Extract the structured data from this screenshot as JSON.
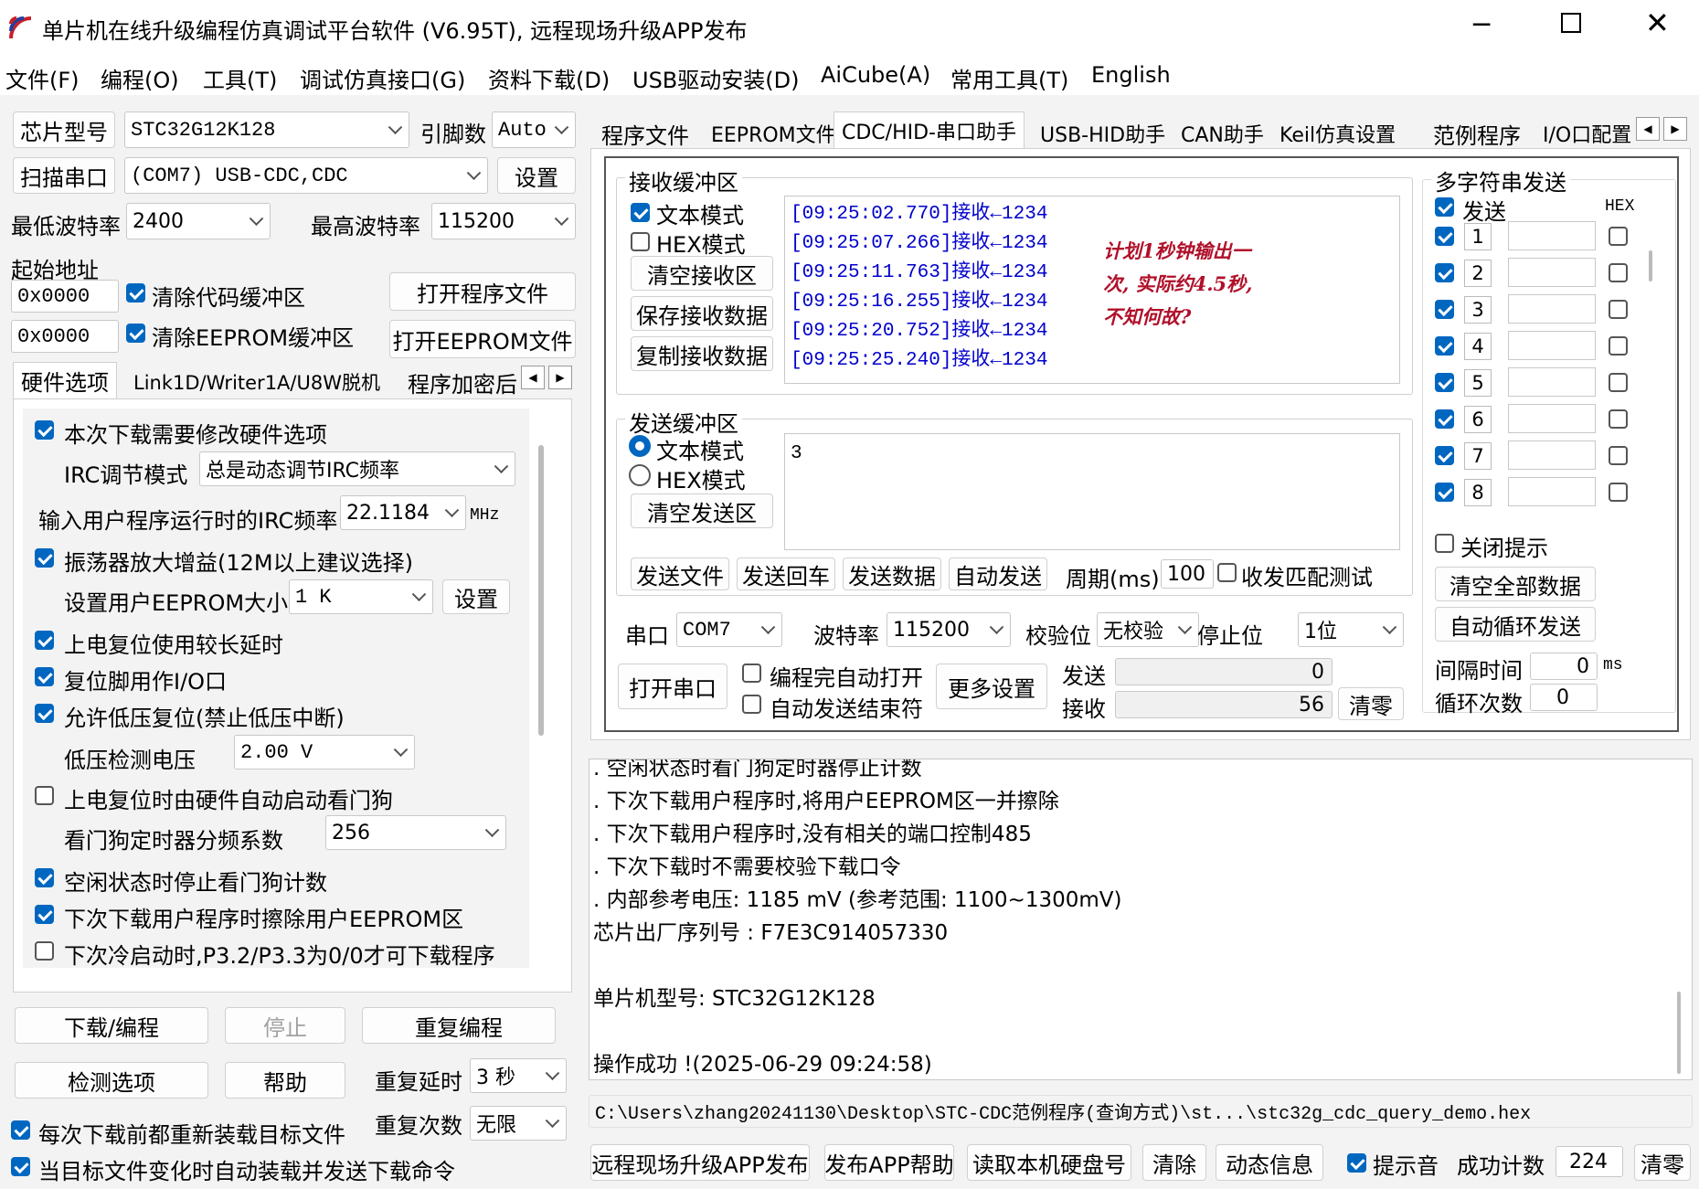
{
  "window": {
    "title": "单片机在线升级编程仿真调试平台软件 (V6.95T), 远程现场升级APP发布"
  },
  "menu": [
    "文件(F)",
    "编程(O)",
    "工具(T)",
    "调试仿真接口(G)",
    "资料下载(D)",
    "USB驱动安装(D)",
    "AiCube(A)",
    "常用工具(T)",
    "English"
  ],
  "left": {
    "chip_btn": "芯片型号",
    "chip_value": "STC32G12K128",
    "pins_label": "引脚数",
    "pins_value": "Auto",
    "scan_btn": "扫描串口",
    "port_value": "(COM7) USB-CDC,CDC",
    "settings_btn": "设置",
    "min_baud_label": "最低波特率",
    "min_baud_value": "2400",
    "max_baud_label": "最高波特率",
    "max_baud_value": "115200",
    "start_addr_label": "起始地址",
    "addr1": "0x0000",
    "clear_code_label": "清除代码缓冲区",
    "open_prog_btn": "打开程序文件",
    "addr2": "0x0000",
    "clear_eeprom_label": "清除EEPROM缓冲区",
    "open_eeprom_btn": "打开EEPROM文件",
    "tabs": [
      "硬件选项",
      "Link1D/Writer1A/U8W脱机",
      "程序加密后"
    ],
    "hw": {
      "opt1": "本次下载需要修改硬件选项",
      "irc_mode_label": "IRC调节模式",
      "irc_mode_value": "总是动态调节IRC频率",
      "irc_freq_label": "输入用户程序运行时的IRC频率",
      "irc_freq_value": "22.1184",
      "irc_unit": "MHz",
      "opt2": "振荡器放大增益(12M以上建议选择)",
      "eeprom_size_label": "设置用户EEPROM大小",
      "eeprom_size_value": "1  K",
      "eeprom_set_btn": "设置",
      "opt3": "上电复位使用较长延时",
      "opt4": "复位脚用作I/O口",
      "opt5": "允许低压复位(禁止低压中断)",
      "lv_label": "低压检测电压",
      "lv_value": "2.00 V",
      "opt6": "上电复位时由硬件自动启动看门狗",
      "wdt_label": "看门狗定时器分频系数",
      "wdt_value": "256",
      "opt7": "空闲状态时停止看门狗计数",
      "opt8": "下次下载用户程序时擦除用户EEPROM区",
      "opt9": "下次冷启动时,P3.2/P3.3为0/0才可下载程序"
    },
    "download_btn": "下载/编程",
    "stop_btn": "停止",
    "repeat_btn": "重复编程",
    "detect_btn": "检测选项",
    "help_btn": "帮助",
    "repeat_delay_label": "重复延时",
    "repeat_delay_value": "3 秒",
    "repeat_count_label": "重复次数",
    "repeat_count_value": "无限",
    "reload_label": "每次下载前都重新装载目标文件",
    "autoload_label": "当目标文件变化时自动装载并发送下载命令"
  },
  "right": {
    "tabs": [
      "程序文件",
      "EEPROM文件",
      "CDC/HID-串口助手",
      "USB-HID助手",
      "CAN助手",
      "Keil仿真设置",
      "范例程序",
      "I/O口配置"
    ],
    "recv": {
      "title": "接收缓冲区",
      "text_mode": "文本模式",
      "hex_mode": "HEX模式",
      "clear_btn": "清空接收区",
      "save_btn": "保存接收数据",
      "copy_btn": "复制接收数据",
      "lines": [
        "[09:25:02.770]接收←1234",
        "[09:25:07.266]接收←1234",
        "[09:25:11.763]接收←1234",
        "[09:25:16.255]接收←1234",
        "[09:25:20.752]接收←1234",
        "[09:25:25.240]接收←1234"
      ],
      "annotation": "计划1秒钟输出一\n次, 实际约4.5秒,\n不知何故?"
    },
    "send": {
      "title": "发送缓冲区",
      "text_mode": "文本模式",
      "hex_mode": "HEX模式",
      "clear_btn": "清空发送区",
      "content": "3",
      "send_file_btn": "发送文件",
      "send_cr_btn": "发送回车",
      "send_data_btn": "发送数据",
      "auto_send_btn": "自动发送",
      "period_label": "周期(ms)",
      "period_value": "100",
      "match_test_label": "收发匹配测试"
    },
    "port_label": "串口",
    "port_value": "COM7",
    "baud_label": "波特率",
    "baud_value": "115200",
    "parity_label": "校验位",
    "parity_value": "无校验",
    "stop_label": "停止位",
    "stop_value": "1位",
    "open_port_btn": "打开串口",
    "auto_open_label": "编程完自动打开",
    "auto_end_label": "自动发送结束符",
    "more_btn": "更多设置",
    "sent_label": "发送",
    "sent_value": "0",
    "recv_label": "接收",
    "recv_value": "56",
    "clear_btn": "清零",
    "multi": {
      "title": "多字符串发送",
      "send_label": "发送",
      "hex_label": "HEX",
      "rows": [
        "1",
        "2",
        "3",
        "4",
        "5",
        "6",
        "7",
        "8"
      ],
      "close_tip_label": "关闭提示",
      "clear_all_btn": "清空全部数据",
      "auto_loop_btn": "自动循环发送",
      "interval_label": "间隔时间",
      "interval_value": "0",
      "interval_unit": "ms",
      "loop_label": "循环次数",
      "loop_value": "0"
    }
  },
  "log": {
    "lines": [
      "  . 空闲状态时看门狗定时器停止计数",
      "  . 下次下载用户程序时,将用户EEPROM区一并擦除",
      "  . 下次下载用户程序时,没有相关的端口控制485",
      "  . 下次下载时不需要校验下载口令",
      "  . 内部参考电压: 1185 mV (参考范围: 1100~1300mV)",
      "芯片出厂序列号 : F7E3C914057330",
      "",
      "  单片机型号: STC32G12K128",
      "",
      "操作成功 !(2025-06-29 09:24:58)"
    ]
  },
  "filepath": "C:\\Users\\zhang20241130\\Desktop\\STC-CDC范例程序(查询方式)\\st...\\stc32g_cdc_query_demo.hex",
  "bottom": {
    "publish_btn": "远程现场升级APP发布",
    "publish_help_btn": "发布APP帮助",
    "read_disk_btn": "读取本机硬盘号",
    "clear_btn": "清除",
    "dynamic_btn": "动态信息",
    "sound_label": "提示音",
    "success_label": "成功计数",
    "success_value": "224",
    "zero_btn": "清零"
  },
  "colors": {
    "accent": "#0067c0",
    "recv_text": "#0000cc",
    "annotation": "#b0102a"
  }
}
